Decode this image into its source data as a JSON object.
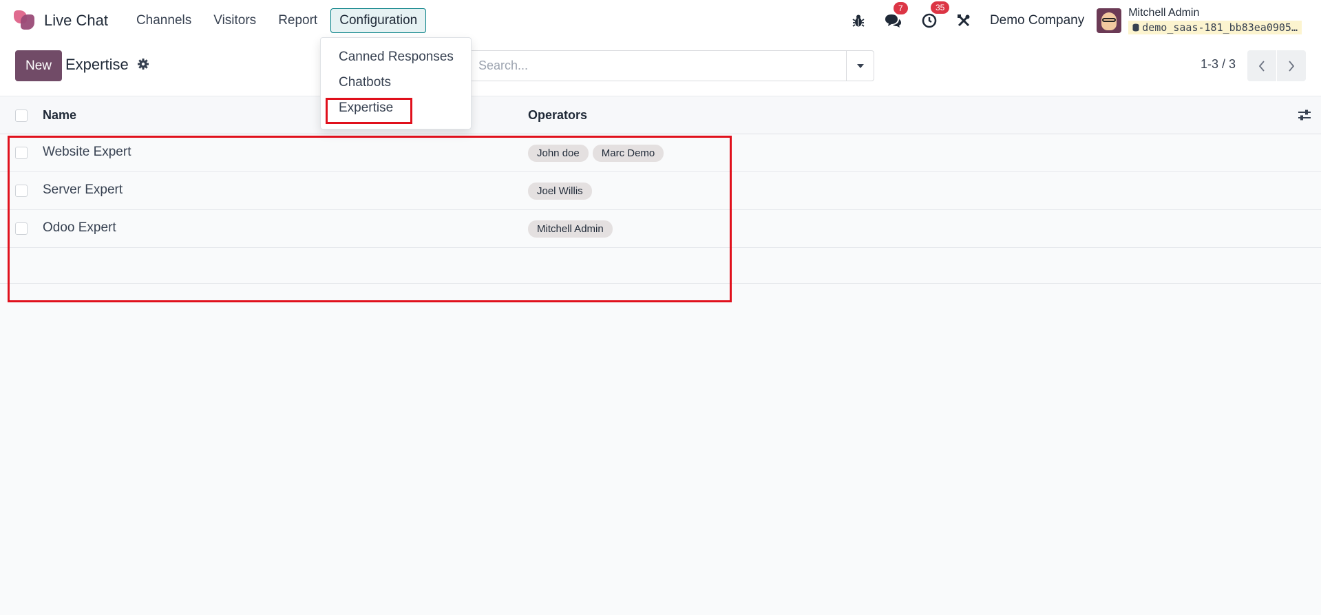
{
  "navbar": {
    "app_name": "Live Chat",
    "menu": [
      "Channels",
      "Visitors",
      "Report",
      "Configuration"
    ],
    "active_menu": "Configuration",
    "messages_badge": "7",
    "activities_badge": "35",
    "company": "Demo Company",
    "user_name": "Mitchell Admin",
    "database": "demo_saas-181_bb83ea0905…"
  },
  "config_menu": {
    "items": [
      "Canned Responses",
      "Chatbots",
      "Expertise"
    ]
  },
  "control_panel": {
    "new_label": "New",
    "title": "Expertise",
    "search_placeholder": "Search...",
    "pager": "1-3 / 3"
  },
  "table": {
    "headers": {
      "name": "Name",
      "operators": "Operators"
    },
    "rows": [
      {
        "name": "Website Expert",
        "operators": [
          "John doe",
          "Marc Demo"
        ]
      },
      {
        "name": "Server Expert",
        "operators": [
          "Joel Willis"
        ]
      },
      {
        "name": "Odoo Expert",
        "operators": [
          "Mitchell Admin"
        ]
      }
    ]
  },
  "colors": {
    "brand": "#714b67",
    "active_menu_border": "#017e84",
    "badge": "#dc3545",
    "highlight": "#e0101c"
  },
  "icons": [
    "app-logo-icon",
    "bug-icon",
    "chat-icon",
    "clock-icon",
    "tools-icon",
    "gear-icon",
    "caret-down-icon",
    "chevron-left-icon",
    "chevron-right-icon",
    "sliders-icon"
  ]
}
